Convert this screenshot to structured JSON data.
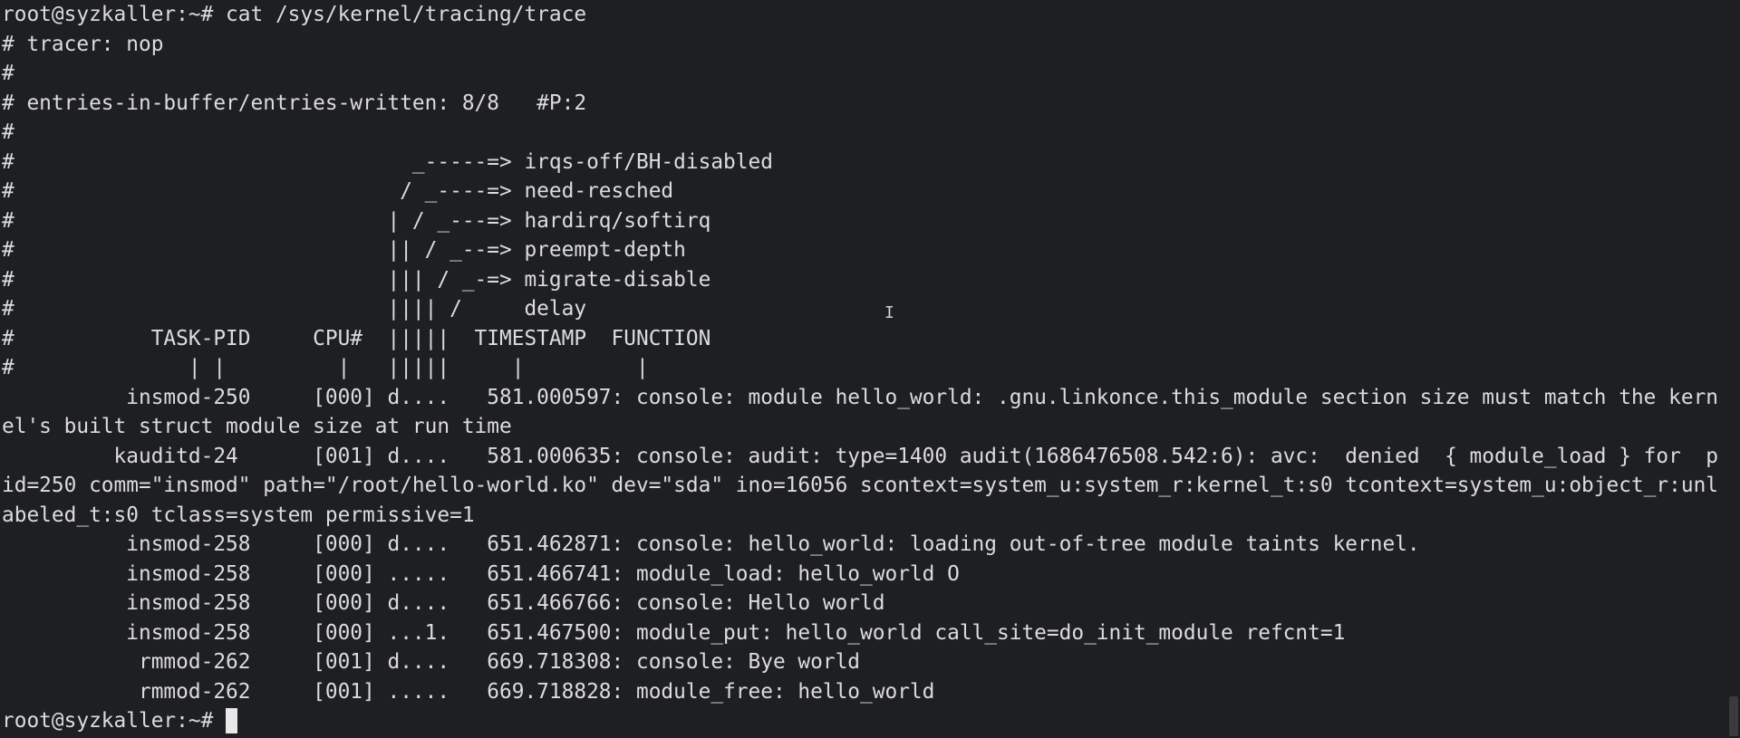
{
  "terminal": {
    "lines": [
      "root@syzkaller:~# cat /sys/kernel/tracing/trace",
      "# tracer: nop",
      "#",
      "# entries-in-buffer/entries-written: 8/8   #P:2",
      "#",
      "#                                _-----=> irqs-off/BH-disabled",
      "#                               / _----=> need-resched",
      "#                              | / _---=> hardirq/softirq",
      "#                              || / _--=> preempt-depth",
      "#                              ||| / _-=> migrate-disable",
      "#                              |||| /     delay",
      "#           TASK-PID     CPU#  |||||  TIMESTAMP  FUNCTION",
      "#              | |         |   |||||     |         |",
      "          insmod-250     [000] d....   581.000597: console: module hello_world: .gnu.linkonce.this_module section size must match the kern",
      "el's built struct module size at run time",
      "         kauditd-24      [001] d....   581.000635: console: audit: type=1400 audit(1686476508.542:6): avc:  denied  { module_load } for  p",
      "id=250 comm=\"insmod\" path=\"/root/hello-world.ko\" dev=\"sda\" ino=16056 scontext=system_u:system_r:kernel_t:s0 tcontext=system_u:object_r:unl",
      "abeled_t:s0 tclass=system permissive=1",
      "          insmod-258     [000] d....   651.462871: console: hello_world: loading out-of-tree module taints kernel.",
      "          insmod-258     [000] .....   651.466741: module_load: hello_world O",
      "          insmod-258     [000] d....   651.466766: console: Hello world",
      "          insmod-258     [000] ...1.   651.467500: module_put: hello_world call_site=do_init_module refcnt=1",
      "           rmmod-262     [001] d....   669.718308: console: Bye world",
      "           rmmod-262     [001] .....   669.718828: module_free: hello_world"
    ],
    "prompt": "root@syzkaller:~# ",
    "colors": {
      "background": "#1e1f22",
      "foreground": "#dcdcdc"
    }
  }
}
